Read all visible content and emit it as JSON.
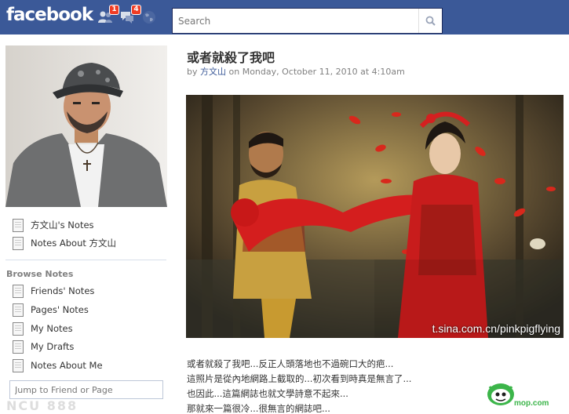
{
  "header": {
    "logo": "facebook",
    "friend_requests_count": "1",
    "messages_count": "4",
    "search_placeholder": "Search"
  },
  "sidebar": {
    "my_links": [
      {
        "label": "方文山's Notes"
      },
      {
        "label": "Notes About 方文山"
      }
    ],
    "browse_title": "Browse Notes",
    "browse_links": [
      {
        "label": "Friends' Notes"
      },
      {
        "label": "Pages' Notes"
      },
      {
        "label": "My Notes"
      },
      {
        "label": "My Drafts"
      },
      {
        "label": "Notes About Me"
      }
    ],
    "jump_placeholder": "Jump to Friend or Page",
    "watermark": "NCU 888"
  },
  "note": {
    "title": "或者就殺了我吧",
    "by": "by",
    "author": "方文山",
    "date": "on Monday, October 11, 2010 at 4:10am",
    "photo_credit": "t.sina.com.cn/pinkpigflying",
    "body": [
      "或者就殺了我吧...反正人頭落地也不過碗口大的疤...",
      "這照片是從內地網路上截取的...初次看到時真是無言了...",
      "也因此...這篇網誌也就文學詩意不起來...",
      "那就來一篇很冷...很無言的網誌吧..."
    ]
  },
  "site_watermark": "mop.com",
  "colors": {
    "brand_blue": "#3b5998",
    "badge_red": "#f03d25",
    "link_blue": "#3b5998"
  }
}
